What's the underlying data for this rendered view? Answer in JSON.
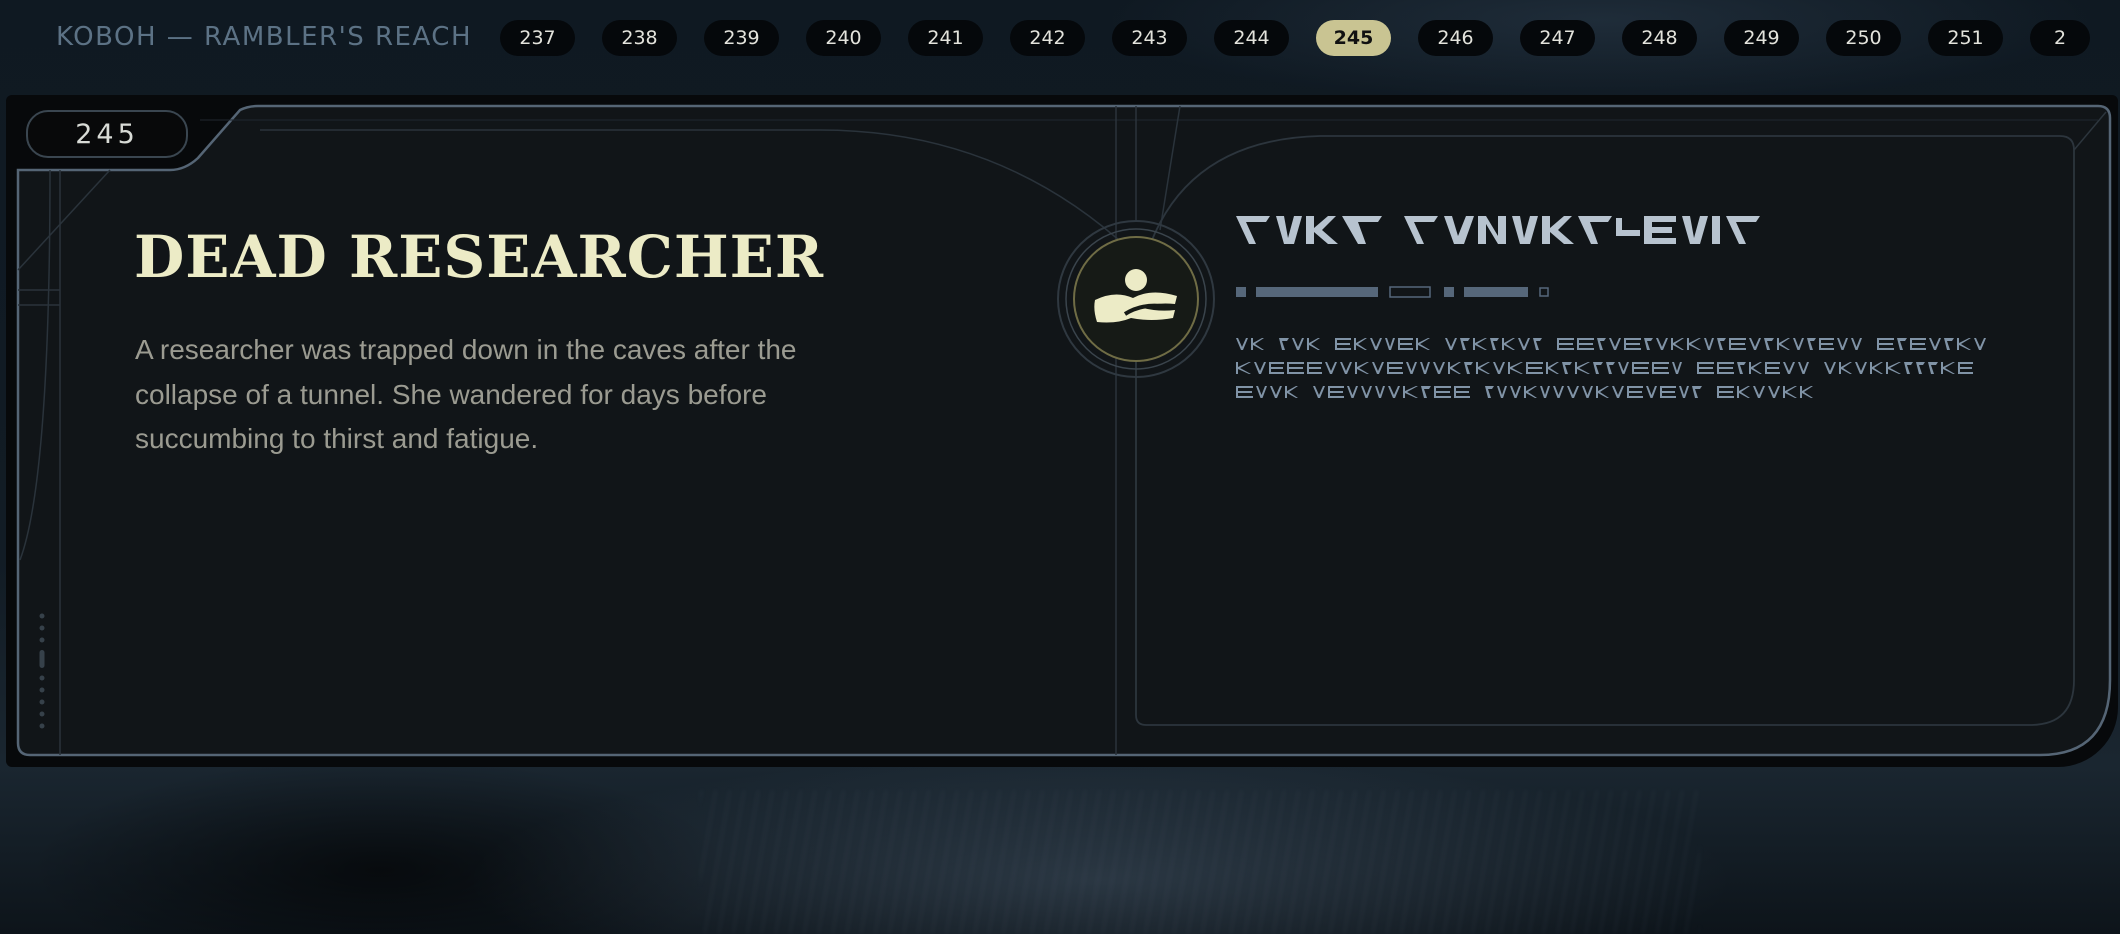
{
  "header": {
    "location": "KOBOH — RAMBLER'S REACH",
    "pages": [
      "237",
      "238",
      "239",
      "240",
      "241",
      "242",
      "243",
      "244",
      "245",
      "246",
      "247",
      "248",
      "249",
      "250",
      "251",
      "2"
    ],
    "active_page": "245"
  },
  "entry": {
    "number": "245",
    "title": "DEAD RESEARCHER",
    "description": "A researcher was trapped down in the caves after the collapse of a tunnel. She wandered for days before succumbing to thirst and fatigue.",
    "emblem_icon": "figure-emblem-icon",
    "alien_title_glyphs": "ᐱᐯᐸᐳ ᐱᐯᐸᐳᐱᐯᐸᐳᐱᐯ",
    "alien_script_lines": [
      "ᐸ ᐱᐯᐸᐳᐱᐯᐸᐳ ᐱᐯᐸ ᐳᐱᐯᐸᐳ ᐱᐯᐸᐳ ᐱᐯ ᐳᐱᐯ ᐸᐳᐱᐯ ᐸᐳᐱᐯ",
      "ᐱᐯᐸ ᐳᐱᐯᐸᐳᐱ ᐯᐸ ᐳ ᐱᐯᐸᐳᐱ. ᐯᐸᐳ ᐱᐯᐸᐳᐱᐯ ᐸᐳᐱ ᐯᐸᐳᐱ",
      "ᐱᐯᐸᐳᐱ ᐯᐸᐳᐱᐯᐸᐳᐱᐯ ᐸᐳ ᐱᐯᐸᐳᐱ ᐯᐸᐳ ᐱᐯᐸᐳᐱᐯ."
    ]
  },
  "colors": {
    "accent": "#c9c492",
    "title": "#ecebc6",
    "frame": "#5a6b7a",
    "alien_text": "#8fa3b8"
  }
}
